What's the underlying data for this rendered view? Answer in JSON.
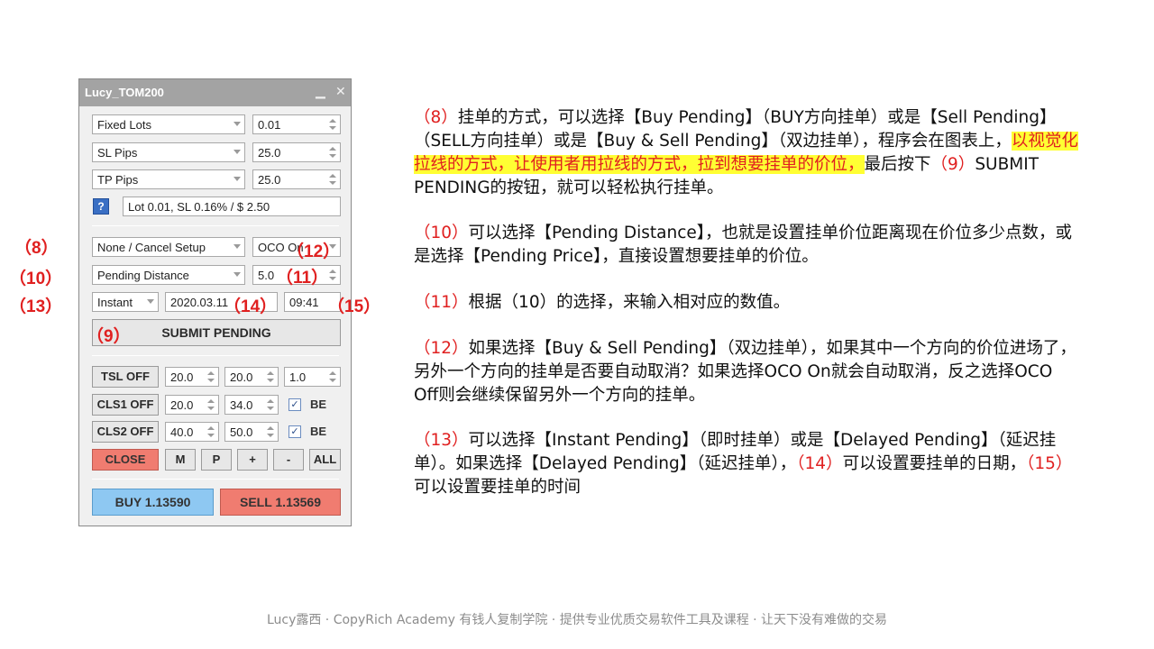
{
  "panel": {
    "title": "Lucy_TOM200",
    "minimize": "▁",
    "close_x": "✕",
    "lot_mode": "Fixed Lots",
    "lot_value": "0.01",
    "sl_mode": "SL Pips",
    "sl_value": "25.0",
    "tp_mode": "TP Pips",
    "tp_value": "25.0",
    "help": "?",
    "info": "Lot 0.01, SL 0.16% / $ 2.50",
    "pending_type": "None / Cancel Setup",
    "oco": "OCO On",
    "pending_mode": "Pending Distance",
    "pending_value": "5.0",
    "timing_mode": "Instant",
    "date": "2020.03.11",
    "time": "09:41",
    "submit": "SUBMIT PENDING",
    "tsl": "TSL OFF",
    "tsl_v1": "20.0",
    "tsl_v2": "20.0",
    "tsl_v3": "1.0",
    "cls1": "CLS1 OFF",
    "cls1_v1": "20.0",
    "cls1_v2": "34.0",
    "cls2": "CLS2 OFF",
    "cls2_v1": "40.0",
    "cls2_v2": "50.0",
    "be": "BE",
    "check": "✓",
    "close": "CLOSE",
    "m": "M",
    "p": "P",
    "plus": "+",
    "minus": "-",
    "all": "ALL",
    "buy": "BUY 1.13590",
    "sell": "SELL 1.13569"
  },
  "annotations": {
    "a8": "（8）",
    "a10": "（10）",
    "a13": "（13）",
    "a12": "（12）",
    "a11": "（11）",
    "a14": "（14）",
    "a15": "（15）",
    "a9": "（9）"
  },
  "text": {
    "p1_n": "（8）",
    "p1_a": "挂单的方式，可以选择【Buy Pending】（BUY方向挂单）或是【Sell Pending】（SELL方向挂单）或是【Buy & Sell Pending】（双边挂单），程序会在图表上，",
    "p1_hl": "以视觉化拉线的方式，让使用者用拉线的方式，拉到想要挂单的价位，",
    "p1_b": "最后按下",
    "p1_n9": "（9）",
    "p1_c": "SUBMIT PENDING的按钮，就可以轻松执行挂单。",
    "p2_n": "（10）",
    "p2": "可以选择【Pending Distance】，也就是设置挂单价位距离现在价位多少点数，或是选择【Pending Price】，直接设置想要挂单的价位。",
    "p3_n": "（11）",
    "p3": "根据（10）的选择，来输入相对应的数值。",
    "p4_n": "（12）",
    "p4": "如果选择【Buy & Sell Pending】（双边挂单），如果其中一个方向的价位进场了，另外一个方向的挂单是否要自动取消？如果选择OCO On就会自动取消，反之选择OCO Off则会继续保留另外一个方向的挂单。",
    "p5_n": "（13）",
    "p5_a": "可以选择【Instant Pending】（即时挂单）或是【Delayed Pending】（延迟挂单）。如果选择【Delayed Pending】（延迟挂单），",
    "p5_n14": "（14）",
    "p5_b": "可以设置要挂单的日期，",
    "p5_n15": "（15）",
    "p5_c": "可以设置要挂单的时间"
  },
  "footer": "Lucy露西 · CopyRich Academy 有钱人复制学院 · 提供专业优质交易软件工具及课程 · 让天下没有难做的交易",
  "colors": {
    "accent_red": "#e02020",
    "highlight": "#ffff33",
    "buy": "#8ec8f2",
    "sell": "#f07c70"
  }
}
